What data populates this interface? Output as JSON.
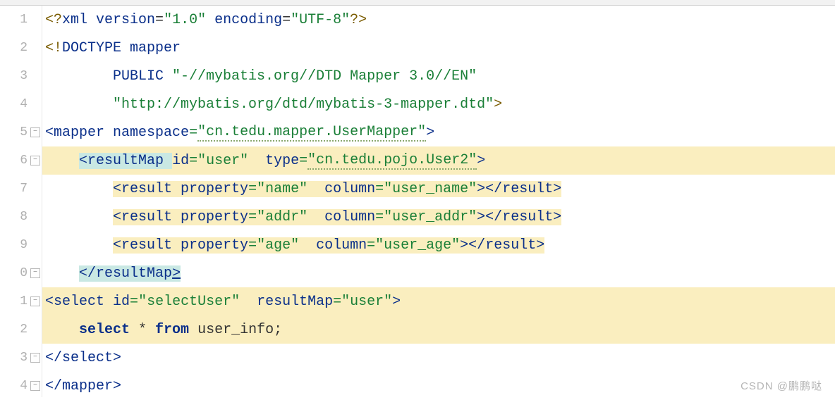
{
  "tabs": [
    {
      "label": ""
    },
    {
      "label": ""
    },
    {
      "label": ""
    },
    {
      "label": ""
    },
    {
      "label": ""
    },
    {
      "label": ""
    }
  ],
  "gutter_numbers": [
    "1",
    "2",
    "3",
    "4",
    "5",
    "6",
    "7",
    "8",
    "9",
    "0",
    "1",
    "2",
    "3",
    "4"
  ],
  "code": {
    "l1": {
      "a": "<?",
      "b": "xml version",
      "c": "=",
      "d": "\"1.0\"",
      "e": " encoding",
      "f": "=",
      "g": "\"UTF-8\"",
      "h": "?>"
    },
    "l2": {
      "a": "<!",
      "b": "DOCTYPE ",
      "c": "mapper"
    },
    "l3": {
      "a": "        PUBLIC ",
      "b": "\"-//mybatis.org//DTD Mapper 3.0//EN\""
    },
    "l4": {
      "a": "        ",
      "b": "\"http://mybatis.org/dtd/mybatis-3-mapper.dtd\"",
      "c": ">"
    },
    "l5": {
      "a": "<",
      "b": "mapper ",
      "c": "namespace",
      "d": "=",
      "e": "\"cn.tedu.mapper.UserMapper\"",
      "f": ">"
    },
    "l6": {
      "a": "    ",
      "b": "<",
      "c": "resultMap ",
      "d": "id",
      "e": "=",
      "f": "\"user\"",
      "g": "  ",
      "h": "type",
      "i": "=",
      "j": "\"cn.tedu.pojo.User2\"",
      "k": ">"
    },
    "l7": {
      "a": "        ",
      "b": "<",
      "c": "result ",
      "d": "property",
      "e": "=",
      "f": "\"name\"",
      "g": "  ",
      "h": "column",
      "i": "=",
      "j": "\"user_name\"",
      "k": "></",
      "l": "result",
      "m": ">"
    },
    "l8": {
      "a": "        ",
      "b": "<",
      "c": "result ",
      "d": "property",
      "e": "=",
      "f": "\"addr\"",
      "g": "  ",
      "h": "column",
      "i": "=",
      "j": "\"user_addr\"",
      "k": "></",
      "l": "result",
      "m": ">"
    },
    "l9": {
      "a": "        ",
      "b": "<",
      "c": "result ",
      "d": "property",
      "e": "=",
      "f": "\"age\"",
      "g": "  ",
      "h": "column",
      "i": "=",
      "j": "\"user_age\"",
      "k": "></",
      "l": "result",
      "m": ">"
    },
    "l10": {
      "a": "    ",
      "b": "</",
      "c": "resultMap",
      "d": ">"
    },
    "l11": {
      "a": "<",
      "b": "select ",
      "c": "id",
      "d": "=",
      "e": "\"selectUser\"",
      "f": "  ",
      "g": "resultMap",
      "h": "=",
      "i": "\"user\"",
      "j": ">"
    },
    "l12": {
      "a": "    ",
      "b": "select",
      "c": " * ",
      "d": "from",
      "e": " user_info;"
    },
    "l13": {
      "a": "</",
      "b": "select",
      "c": ">"
    },
    "l14": {
      "a": "</",
      "b": "mapper",
      "c": ">"
    }
  },
  "watermark": "CSDN @鹏鹏哒"
}
